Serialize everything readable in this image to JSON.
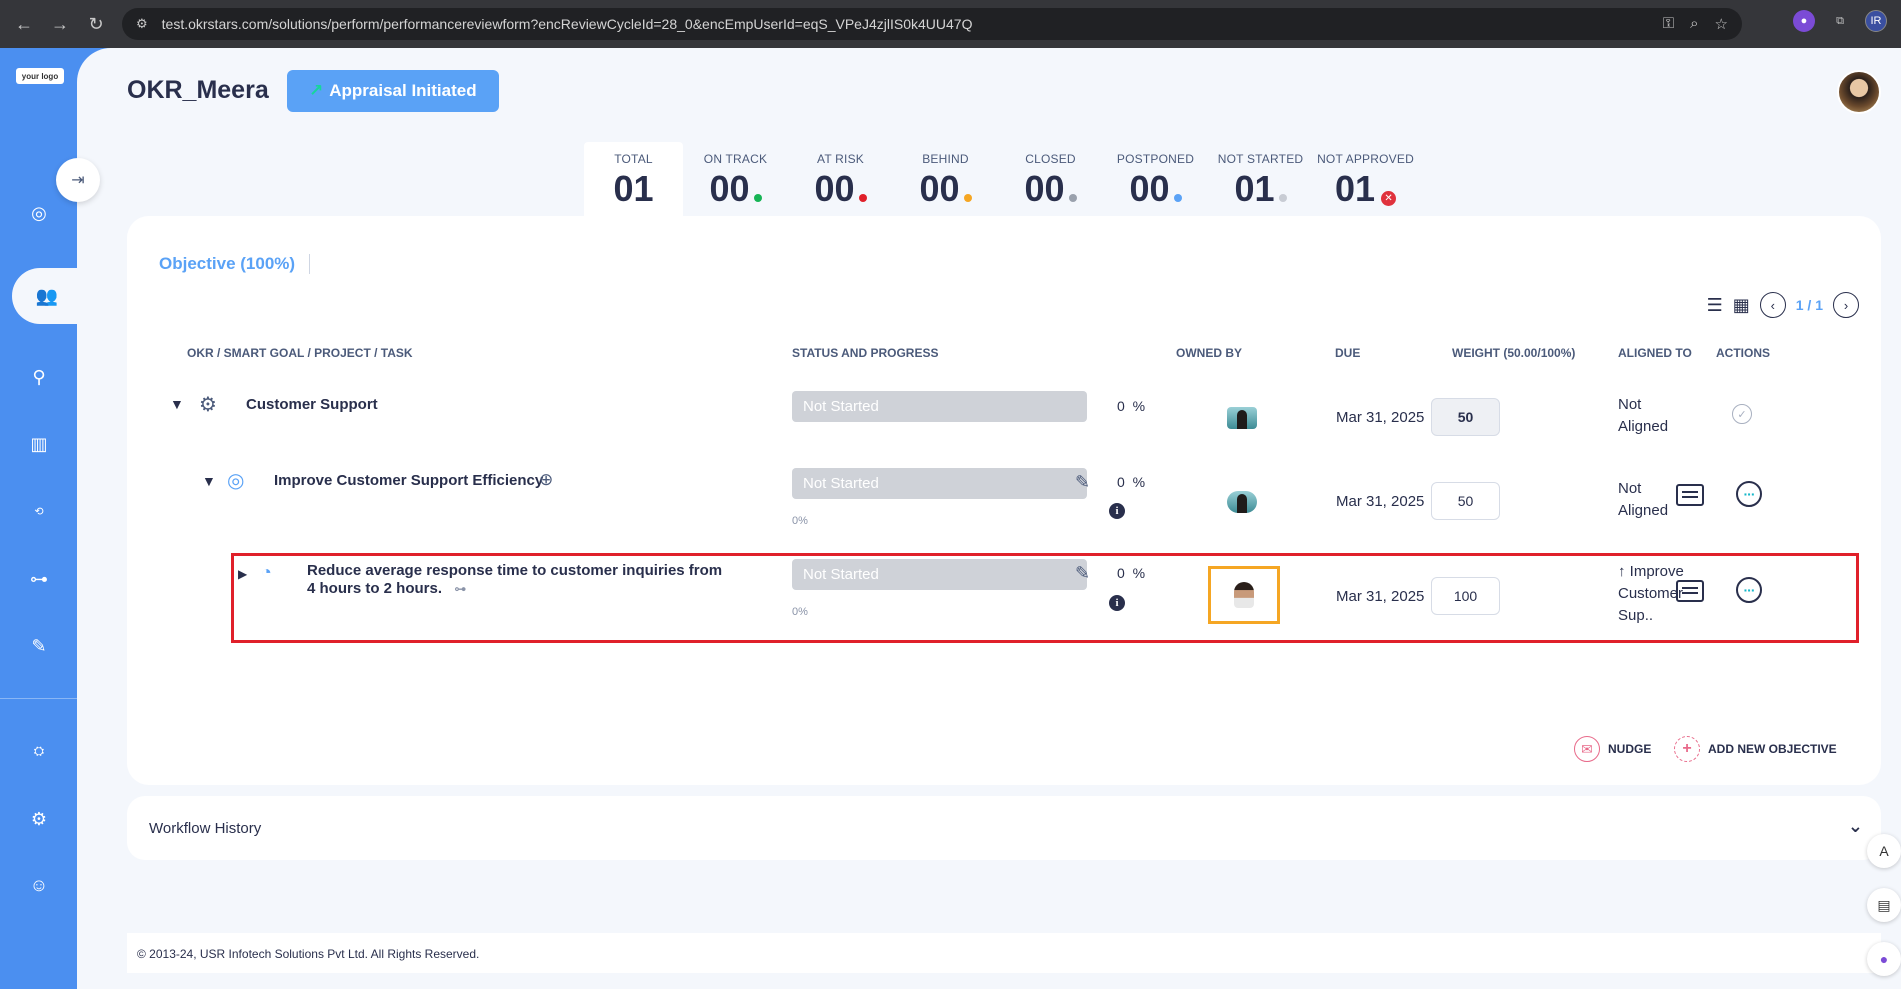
{
  "browser": {
    "url": "test.okrstars.com/solutions/perform/performancereviewform?encReviewCycleId=28_0&encEmpUserId=eqS_VPeJ4zjlIS0k4UU47Q",
    "ext_label": "IR"
  },
  "sidebar": {
    "logo_text": "your logo",
    "items": [
      "target-icon",
      "team-icon",
      "person-icon",
      "book-icon",
      "360-icon",
      "hierarchy-icon",
      "note-icon",
      "network-icon",
      "gear-icon",
      "support-icon"
    ]
  },
  "header": {
    "title": "OKR_Meera",
    "appraisal_label": "Appraisal Initiated"
  },
  "stats": [
    {
      "label": "TOTAL",
      "value": "01",
      "color": ""
    },
    {
      "label": "ON TRACK",
      "value": "00",
      "color": "#16b455"
    },
    {
      "label": "AT RISK",
      "value": "00",
      "color": "#e0202a"
    },
    {
      "label": "BEHIND",
      "value": "00",
      "color": "#f5a623"
    },
    {
      "label": "CLOSED",
      "value": "00",
      "color": "#9aa1ad"
    },
    {
      "label": "POSTPONED",
      "value": "00",
      "color": "#5aa2f6"
    },
    {
      "label": "NOT STARTED",
      "value": "01",
      "color": "#c8ccd4"
    },
    {
      "label": "NOT APPROVED",
      "value": "01",
      "color": "#e0323d"
    }
  ],
  "objective_tab": "Objective (100%)",
  "pager": "1 / 1",
  "columns": {
    "okr": "OKR / SMART GOAL / PROJECT / TASK",
    "status": "STATUS AND PROGRESS",
    "owned": "OWNED BY",
    "due": "DUE",
    "weight": "WEIGHT (50.00/100%)",
    "aligned": "ALIGNED TO",
    "actions": "ACTIONS"
  },
  "rows": [
    {
      "title": "Customer Support",
      "status": "Not Started",
      "progress_text": "",
      "pct": "0",
      "due": "Mar 31, 2025",
      "weight": "50",
      "aligned_l1": "Not",
      "aligned_l2": "Aligned",
      "aligned_l3": ""
    },
    {
      "title": "Improve Customer Support Efficiency",
      "status": "Not Started",
      "progress_text": "0%",
      "pct": "0",
      "due": "Mar 31, 2025",
      "weight": "50",
      "aligned_l1": "Not",
      "aligned_l2": "Aligned",
      "aligned_l3": ""
    },
    {
      "title_l1": "Reduce average response time to customer inquiries from",
      "title_l2": "4 hours to 2 hours.",
      "status": "Not Started",
      "progress_text": "0%",
      "pct": "0",
      "due": "Mar 31, 2025",
      "weight": "100",
      "aligned_l1": "↑ Improve",
      "aligned_l2": "Customer",
      "aligned_l3": "Sup.."
    }
  ],
  "pct_symbol": "%",
  "actions": {
    "nudge": "NUDGE",
    "add_objective": "ADD NEW OBJECTIVE"
  },
  "workflow": {
    "title": "Workflow History"
  },
  "footer": "© 2013-24, USR Infotech Solutions Pvt Ltd. All Rights Reserved."
}
